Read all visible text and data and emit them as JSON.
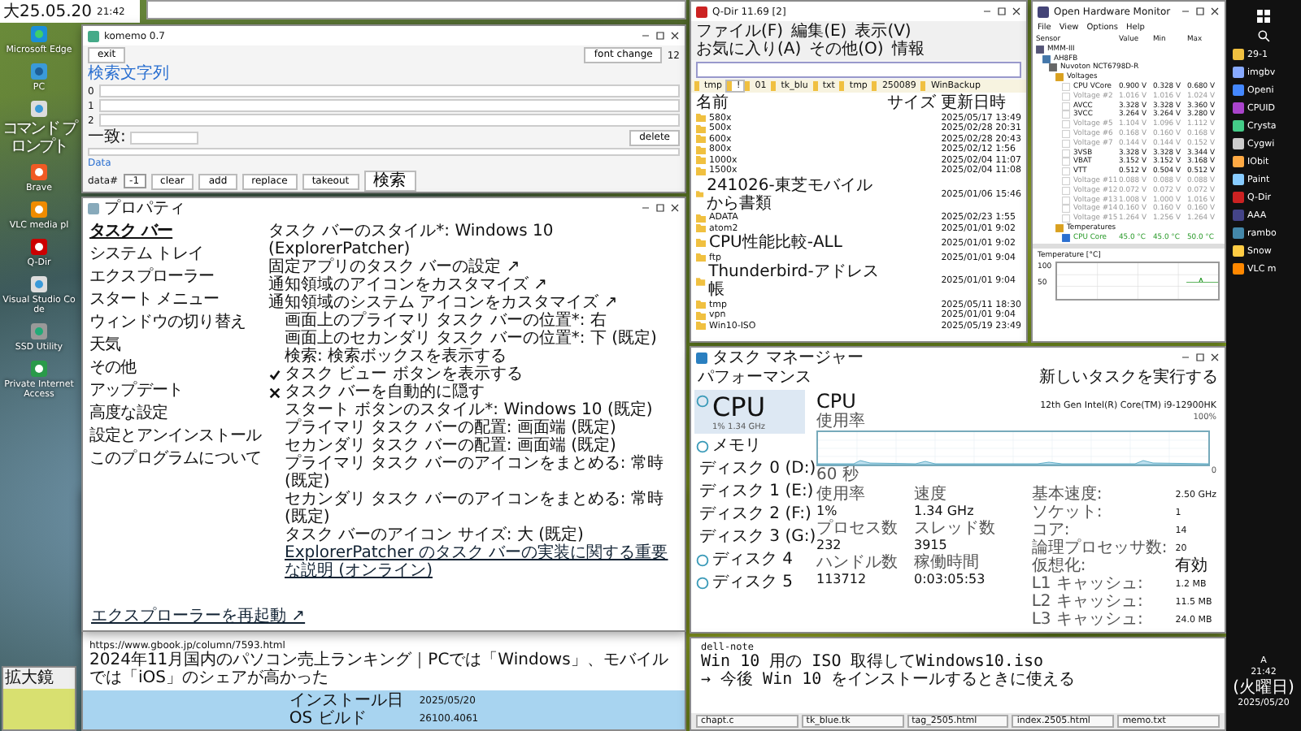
{
  "clock_widget": {
    "date": "大25.05.20",
    "time": "21:42"
  },
  "desktop_icons": [
    {
      "label": "Microsoft Edge",
      "kind": "edge"
    },
    {
      "label": "PC",
      "kind": "monitor"
    },
    {
      "label": "コマンド プロンプト",
      "kind": "file"
    },
    {
      "label": "Brave",
      "kind": "brave"
    },
    {
      "label": "VLC media pl",
      "kind": "vlc"
    },
    {
      "label": "Q-Dir",
      "kind": "qdir"
    },
    {
      "label": "Visual Studio Code",
      "kind": "file"
    },
    {
      "label": "SSD Utility",
      "kind": "gear"
    },
    {
      "label": "Private Internet Access",
      "kind": "lock"
    }
  ],
  "magnifier": {
    "title": "拡大鏡"
  },
  "clip_window": {
    "lines": [
      "https://www.gbook.jp/column/7593.html",
      "2024年11月国内のパソコン売上ランキング｜PCでは「Windows」、モバイルでは「iOS」のシェアが高かった"
    ],
    "install_label": "インストール日",
    "install_date": "2025/05/20",
    "build_label": "OS ビルド",
    "build": "26100.4061"
  },
  "editor_lines": [
    "dell-note",
    "Win 10 用の ISO 取得してWindows10.iso",
    "→ 今後 Win 10 をインストールするときに使える"
  ],
  "open_files": [
    "chapt.c",
    "tk_blue.tk",
    "tag_2505.html",
    "index.2505.html",
    "memo.txt"
  ],
  "memo_window": {
    "title": "komemo 0.7",
    "exit": "exit",
    "font_button": "font change",
    "font_size": "12",
    "search_label": "検索文字列",
    "rows": [
      "0",
      "1",
      "2"
    ],
    "match_label": "一致:",
    "delete": "delete",
    "data_label": "Data",
    "data_field": "data#",
    "index_value": "-1",
    "buttons": [
      "clear",
      "add",
      "replace",
      "takeout"
    ],
    "search_button": "検索"
  },
  "properties_dialog": {
    "title": "プロパティ",
    "nav": [
      {
        "label": "タスク バー",
        "selected": true
      },
      {
        "label": "システム トレイ",
        "selected": false
      },
      {
        "label": "エクスプローラー",
        "selected": false
      },
      {
        "label": "スタート メニュー",
        "selected": false
      },
      {
        "label": "ウィンドウの切り替え",
        "selected": false
      },
      {
        "label": "天気",
        "selected": false
      },
      {
        "label": "その他",
        "selected": false
      },
      {
        "label": "アップデート",
        "selected": false
      },
      {
        "label": "高度な設定",
        "selected": false
      },
      {
        "label": "設定とアンインストール",
        "selected": false
      },
      {
        "label": "このプログラムについて",
        "selected": false
      }
    ],
    "options": [
      {
        "kind": "option",
        "text": "タスク バーのスタイル*: Windows 10 (ExplorerPatcher)"
      },
      {
        "kind": "option",
        "text": "固定アプリのタスク バーの設定 ↗"
      },
      {
        "kind": "option",
        "text": "通知領域のアイコンをカスタマイズ ↗"
      },
      {
        "kind": "option",
        "text": "通知領域のシステム アイコンをカスタマイズ ↗"
      },
      {
        "kind": "suboption",
        "text": "画面上のプライマリ タスク バーの位置*: 右"
      },
      {
        "kind": "suboption",
        "text": "画面上のセカンダリ タスク バーの位置*: 下 (既定)"
      },
      {
        "kind": "suboption",
        "text": "検索: 検索ボックスを表示する"
      },
      {
        "kind": "checkbox",
        "text": "タスク ビュー ボタンを表示する",
        "checked": true
      },
      {
        "kind": "checkbox",
        "text": "タスク バーを自動的に隠す",
        "checked": false
      },
      {
        "kind": "suboption",
        "text": "スタート ボタンのスタイル*: Windows 10 (既定)"
      },
      {
        "kind": "suboption",
        "text": "プライマリ タスク バーの配置: 画面端 (既定)"
      },
      {
        "kind": "suboption",
        "text": "セカンダリ タスク バーの配置: 画面端 (既定)"
      },
      {
        "kind": "suboption",
        "text": "プライマリ タスク バーのアイコンをまとめる: 常時 (既定)"
      },
      {
        "kind": "suboption",
        "text": "セカンダリ タスク バーのアイコンをまとめる: 常時 (既定)"
      },
      {
        "kind": "suboption",
        "text": "タスク バーのアイコン サイズ: 大 (既定)"
      },
      {
        "kind": "link",
        "text": "ExplorerPatcher のタスク バーの実装に関する重要な説明 (オンライン)"
      }
    ],
    "restart_link": "エクスプローラーを再起動 ↗"
  },
  "file_manager": {
    "title": "Q-Dir 11.69 [2]",
    "menu": [
      "ファイル(F)",
      "編集(E)",
      "表示(V)",
      "お気に入り(A)",
      "その他(O)",
      "情報"
    ],
    "tabs": [
      {
        "label": "tmp",
        "selected": false
      },
      {
        "label": "!",
        "selected": true
      },
      {
        "label": "01",
        "selected": false
      },
      {
        "label": "tk_blu",
        "selected": false
      },
      {
        "label": "txt",
        "selected": false
      },
      {
        "label": "tmp",
        "selected": false
      },
      {
        "label": "250089",
        "selected": false
      },
      {
        "label": "WinBackup",
        "selected": false
      }
    ],
    "columns": [
      "名前",
      "サイズ",
      "更新日時"
    ],
    "rows": [
      [
        "580x",
        "2025/05/17 13:49"
      ],
      [
        "500x",
        "2025/02/28 20:31"
      ],
      [
        "600x",
        "2025/02/28 20:43"
      ],
      [
        "800x",
        "2025/02/12 1:56"
      ],
      [
        "1000x",
        "2025/02/04 11:07"
      ],
      [
        "1500x",
        "2025/02/04 11:08"
      ],
      [
        "241026-東芝モバイルから書類",
        "2025/01/06 15:46"
      ],
      [
        "ADATA",
        "2025/02/23 1:55"
      ],
      [
        "atom2",
        "2025/01/01 9:02"
      ],
      [
        "CPU性能比較-ALL",
        "2025/01/01 9:02"
      ],
      [
        "ftp",
        "2025/01/01 9:04"
      ],
      [
        "Thunderbird-アドレス帳",
        "2025/01/01 9:04"
      ],
      [
        "tmp",
        "2025/05/11 18:30"
      ],
      [
        "vpn",
        "2025/01/01 9:04"
      ],
      [
        "Win10-ISO",
        "2025/05/19 23:49"
      ]
    ]
  },
  "hardware_monitor": {
    "title": "Open Hardware Monitor",
    "menu": [
      "File",
      "View",
      "Options",
      "Help"
    ],
    "columns": [
      "Sensor",
      "Value",
      "Min",
      "Max"
    ],
    "tree": [
      {
        "name": "MMM-III",
        "kind": "computer",
        "children": [
          {
            "name": "AH8FB",
            "kind": "board",
            "children": [
              {
                "name": "Nuvoton NCT6798D-R",
                "kind": "chip",
                "children": [
                  {
                    "name": "Voltages",
                    "kind": "group",
                    "children": [
                      {
                        "name": "CPU VCore",
                        "kind": "sensor",
                        "disabled": false,
                        "value": "0.900 V",
                        "min": "0.328 V",
                        "max": "0.680 V"
                      },
                      {
                        "name": "Voltage #2",
                        "kind": "sensor",
                        "disabled": true,
                        "value": "1.016 V",
                        "min": "1.016 V",
                        "max": "1.024 V"
                      },
                      {
                        "name": "AVCC",
                        "kind": "sensor",
                        "disabled": false,
                        "value": "3.328 V",
                        "min": "3.328 V",
                        "max": "3.360 V"
                      },
                      {
                        "name": "3VCC",
                        "kind": "sensor",
                        "disabled": false,
                        "value": "3.264 V",
                        "min": "3.264 V",
                        "max": "3.280 V"
                      },
                      {
                        "name": "Voltage #5",
                        "kind": "sensor",
                        "disabled": true,
                        "value": "1.104 V",
                        "min": "1.096 V",
                        "max": "1.112 V"
                      },
                      {
                        "name": "Voltage #6",
                        "kind": "sensor",
                        "disabled": true,
                        "value": "0.168 V",
                        "min": "0.160 V",
                        "max": "0.168 V"
                      },
                      {
                        "name": "Voltage #7",
                        "kind": "sensor",
                        "disabled": true,
                        "value": "0.144 V",
                        "min": "0.144 V",
                        "max": "0.152 V"
                      },
                      {
                        "name": "3VSB",
                        "kind": "sensor",
                        "disabled": false,
                        "value": "3.328 V",
                        "min": "3.328 V",
                        "max": "3.344 V"
                      },
                      {
                        "name": "VBAT",
                        "kind": "sensor",
                        "disabled": false,
                        "value": "3.152 V",
                        "min": "3.152 V",
                        "max": "3.168 V"
                      },
                      {
                        "name": "VTT",
                        "kind": "sensor",
                        "disabled": false,
                        "value": "0.512 V",
                        "min": "0.504 V",
                        "max": "0.512 V"
                      },
                      {
                        "name": "Voltage #11",
                        "kind": "sensor",
                        "disabled": true,
                        "value": "0.088 V",
                        "min": "0.088 V",
                        "max": "0.088 V"
                      },
                      {
                        "name": "Voltage #12",
                        "kind": "sensor",
                        "disabled": true,
                        "value": "0.072 V",
                        "min": "0.072 V",
                        "max": "0.072 V"
                      },
                      {
                        "name": "Voltage #13",
                        "kind": "sensor",
                        "disabled": true,
                        "value": "1.008 V",
                        "min": "1.000 V",
                        "max": "1.016 V"
                      },
                      {
                        "name": "Voltage #14",
                        "kind": "sensor",
                        "disabled": true,
                        "value": "0.160 V",
                        "min": "0.160 V",
                        "max": "0.160 V"
                      },
                      {
                        "name": "Voltage #15",
                        "kind": "sensor",
                        "disabled": true,
                        "value": "1.264 V",
                        "min": "1.256 V",
                        "max": "1.264 V"
                      }
                    ]
                  },
                  {
                    "name": "Temperatures",
                    "kind": "group",
                    "children": [
                      {
                        "name": "CPU Core",
                        "kind": "temp",
                        "disabled": false,
                        "value": "45.0 °C",
                        "min": "45.0 °C",
                        "max": "50.0 °C"
                      }
                    ]
                  }
                ]
              }
            ]
          }
        ]
      }
    ],
    "plot": {
      "axis_label": "Temperature [°C]",
      "ticks": [
        "100",
        "50"
      ]
    }
  },
  "task_manager": {
    "title": "タスク マネージャー",
    "section": "パフォーマンス",
    "run_task": "新しいタスクを実行する",
    "devices": [
      {
        "name": "CPU",
        "detail": "1% 1.34 GHz",
        "selected": true
      },
      {
        "name": "メモリ",
        "selected": false
      },
      {
        "name": "ディスク 0 (D:)",
        "selected": false
      },
      {
        "name": "ディスク 1 (E:)",
        "selected": false
      },
      {
        "name": "ディスク 2 (F:)",
        "selected": false
      },
      {
        "name": "ディスク 3 (G:)",
        "selected": false
      },
      {
        "name": "ディスク 4",
        "selected": false
      },
      {
        "name": "ディスク 5",
        "selected": false
      }
    ],
    "heading": "CPU",
    "model": "12th Gen Intel(R) Core(TM) i9-12900HK",
    "graph_label": "使用率",
    "graph_max": "100%",
    "graph_span": "60 秒",
    "graph_min": "0",
    "stats": [
      {
        "label": "使用率",
        "value": "1%"
      },
      {
        "label": "速度",
        "value": "1.34 GHz"
      },
      {
        "label": "プロセス数",
        "value": "232"
      },
      {
        "label": "スレッド数",
        "value": "3915"
      },
      {
        "label": "ハンドル数",
        "value": "113712"
      },
      {
        "label": "稼働時間",
        "value": "0:03:05:53"
      }
    ],
    "specs": [
      {
        "label": "基本速度:",
        "value": "2.50 GHz"
      },
      {
        "label": "ソケット:",
        "value": "1"
      },
      {
        "label": "コア:",
        "value": "14"
      },
      {
        "label": "論理プロセッサ数:",
        "value": "20"
      },
      {
        "label": "仮想化:",
        "value": "有効"
      },
      {
        "label": "L1 キャッシュ:",
        "value": "1.2 MB"
      },
      {
        "label": "L2 キャッシュ:",
        "value": "11.5 MB"
      },
      {
        "label": "L3 キャッシュ:",
        "value": "24.0 MB"
      }
    ]
  },
  "taskbar": {
    "apps": [
      "29-1",
      "imgbv",
      "Openi",
      "CPUID",
      "Crysta",
      "Cygwi",
      "IObit",
      "Paint",
      "Q-Dir",
      "AAA",
      "rambo",
      "Snow",
      "VLC m"
    ],
    "ime": "A",
    "time": "21:42",
    "day": "(火曜日)",
    "date": "2025/05/20"
  }
}
